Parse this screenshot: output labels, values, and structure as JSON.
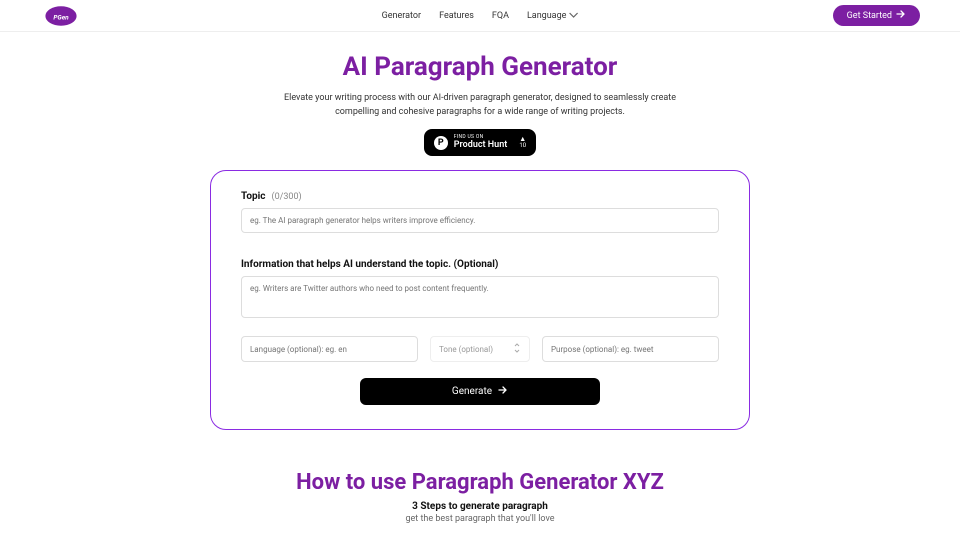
{
  "nav": {
    "generator": "Generator",
    "features": "Features",
    "fqa": "FQA",
    "language": "Language"
  },
  "cta": "Get Started",
  "hero": {
    "title": "AI Paragraph Generator",
    "subtitle": "Elevate your writing process with our AI-driven paragraph generator, designed to seamlessly create compelling and cohesive paragraphs for a wide range of writing projects."
  },
  "ph": {
    "find": "FIND US ON",
    "name": "Product Hunt",
    "votes": "10"
  },
  "form": {
    "topic_label": "Topic",
    "topic_count": "(0/300)",
    "topic_ph": "eg. The AI paragraph generator helps writers improve efficiency.",
    "info_label": "Information that helps AI understand the topic. (Optional)",
    "info_ph": "eg. Writers are Twitter authors who need to post content frequently.",
    "lang_ph": "Language (optional): eg. en",
    "tone_ph": "Tone (optional)",
    "purpose_ph": "Purpose (optional): eg. tweet",
    "generate": "Generate"
  },
  "howto": {
    "title": "How to use Paragraph Generator XYZ",
    "sub1": "3 Steps to generate paragraph",
    "sub2": "get the best paragraph that you'll love"
  }
}
